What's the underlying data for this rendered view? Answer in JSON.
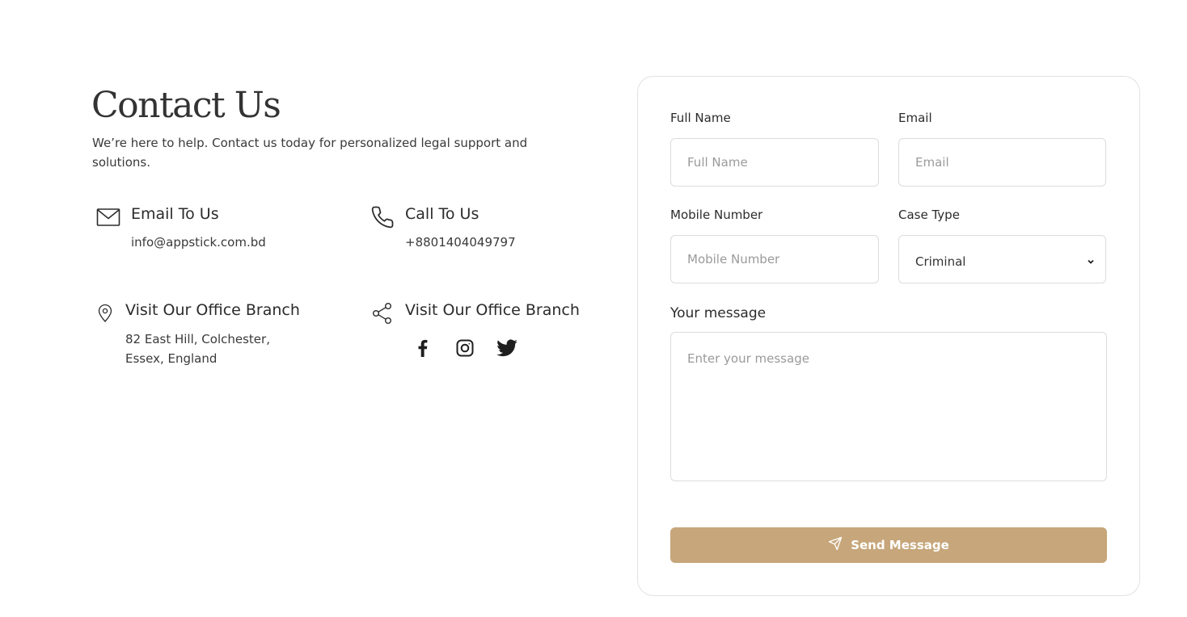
{
  "header": {
    "title": "Contact Us",
    "subtitle": "We’re here to help. Contact us today for personalized legal support and solutions."
  },
  "info": {
    "email": {
      "icon": "mail-icon",
      "title": "Email To Us",
      "value": "info@appstick.com.bd"
    },
    "call": {
      "icon": "phone-icon",
      "title": "Call To Us",
      "value": "+8801404049797"
    },
    "office": {
      "icon": "map-pin-icon",
      "title": "Visit Our Office Branch",
      "line1": "82 East Hill, Colchester,",
      "line2": "Essex, England"
    },
    "social": {
      "icon": "share-icon",
      "title": "Visit Our Office Branch",
      "links": [
        "facebook-icon",
        "instagram-icon",
        "twitter-icon"
      ]
    }
  },
  "form": {
    "full_name": {
      "label": "Full Name",
      "placeholder": "Full Name",
      "value": ""
    },
    "email": {
      "label": "Email",
      "placeholder": "Email",
      "value": ""
    },
    "mobile": {
      "label": "Mobile Number",
      "placeholder": "Mobile Number",
      "value": ""
    },
    "case_type": {
      "label": "Case Type",
      "selected": "Criminal"
    },
    "message": {
      "label": "Your message",
      "placeholder": "Enter your message",
      "value": ""
    },
    "submit_label": "Send Message",
    "submit_icon": "send-icon"
  },
  "colors": {
    "accent": "#c6a67a",
    "text": "#2b2b2b",
    "border": "#dcdcdc"
  }
}
